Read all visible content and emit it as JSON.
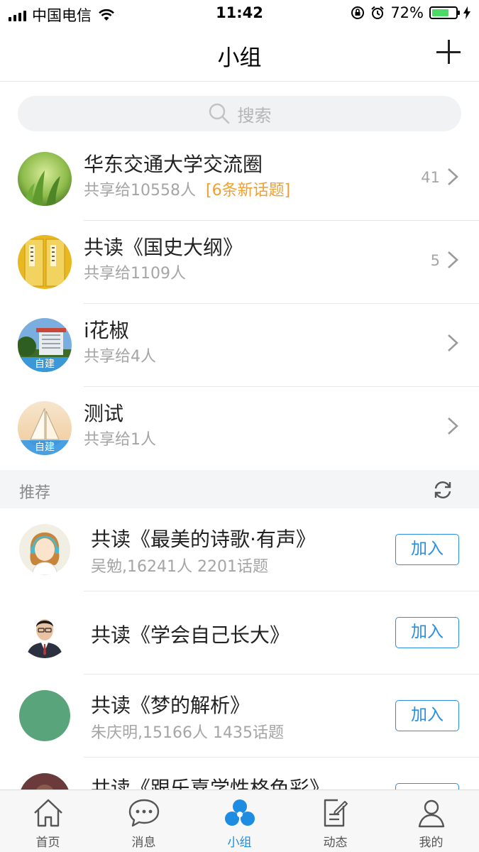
{
  "status_bar": {
    "carrier": "中国电信",
    "time": "11:42",
    "battery": "72%",
    "battery_level": 0.72
  },
  "nav": {
    "title": "小组"
  },
  "search": {
    "placeholder": "搜索"
  },
  "groups": [
    {
      "name": "华东交通大学交流圈",
      "shared": "共享给10558人",
      "new_topics": "[6条新话题]",
      "count": "41",
      "self_built": ""
    },
    {
      "name": "共读《国史大纲》",
      "shared": "共享给1109人",
      "new_topics": "",
      "count": "5",
      "self_built": ""
    },
    {
      "name": "i花椒",
      "shared": "共享给4人",
      "new_topics": "",
      "count": "",
      "self_built": "自建"
    },
    {
      "name": "测试",
      "shared": "共享给1人",
      "new_topics": "",
      "count": "",
      "self_built": "自建"
    }
  ],
  "recommend": {
    "title": "推荐",
    "join_label": "加入",
    "items": [
      {
        "name": "共读《最美的诗歌·有声》",
        "meta": "吴勉,16241人 2201话题"
      },
      {
        "name": "共读《学会自己长大》",
        "meta": ""
      },
      {
        "name": "共读《梦的解析》",
        "meta": "朱庆明,15166人 1435话题"
      },
      {
        "name": "共读《跟乐嘉学性格色彩》",
        "meta": ""
      }
    ]
  },
  "tabbar": {
    "items": [
      {
        "label": "首页",
        "icon": "home-icon",
        "active": false
      },
      {
        "label": "消息",
        "icon": "message-icon",
        "active": false
      },
      {
        "label": "小组",
        "icon": "group-icon",
        "active": true
      },
      {
        "label": "动态",
        "icon": "feed-icon",
        "active": false
      },
      {
        "label": "我的",
        "icon": "profile-icon",
        "active": false
      }
    ]
  },
  "colors": {
    "accent": "#1e8ce0",
    "new_topic": "#f0a030",
    "battery": "#4cd964"
  }
}
